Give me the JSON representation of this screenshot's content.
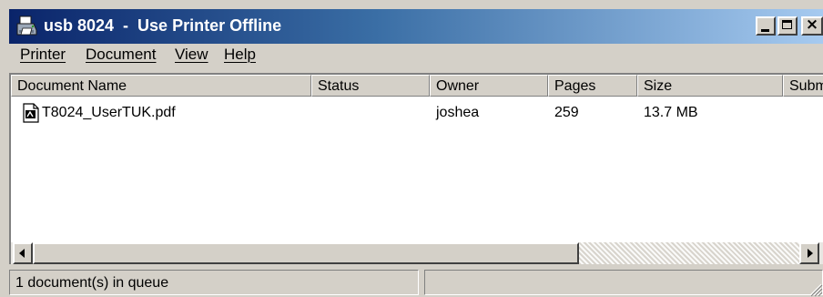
{
  "window": {
    "title": "usb 8024  -  Use Printer Offline",
    "title_icon": "printer-icon",
    "colors": {
      "titlebar_start": "#0a246a",
      "titlebar_end": "#a6caf0",
      "chrome": "#d4d0c8"
    }
  },
  "menu": {
    "items": [
      {
        "label": "Printer"
      },
      {
        "label": "Document"
      },
      {
        "label": "View"
      },
      {
        "label": "Help"
      }
    ]
  },
  "list": {
    "columns": [
      "Document Name",
      "Status",
      "Owner",
      "Pages",
      "Size",
      "Submitted"
    ],
    "rows": [
      {
        "icon": "pdf-document-icon",
        "document_name": "T8024_UserTUK.pdf",
        "status": "",
        "owner": "joshea",
        "pages": "259",
        "size": "13.7 MB",
        "submitted": ""
      }
    ]
  },
  "status_bar": {
    "text": "1 document(s) in queue",
    "secondary": ""
  }
}
